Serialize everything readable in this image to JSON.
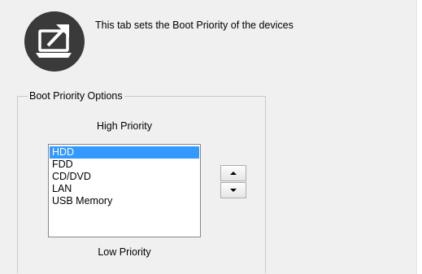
{
  "header": {
    "icon": "monitor-arrow-icon",
    "description": "This tab sets the Boot Priority of the devices"
  },
  "boot_options": {
    "group_label": "Boot Priority Options",
    "high_label": "High Priority",
    "low_label": "Low Priority",
    "items": [
      {
        "label": "HDD",
        "selected": true
      },
      {
        "label": "FDD",
        "selected": false
      },
      {
        "label": "CD/DVD",
        "selected": false
      },
      {
        "label": "LAN",
        "selected": false
      },
      {
        "label": "USB Memory",
        "selected": false
      }
    ],
    "move_up_icon": "triangle-up-icon",
    "move_down_icon": "triangle-down-icon"
  },
  "colors": {
    "panel_bg": "#f0f0f0",
    "selection": "#3399ff",
    "icon_circle": "#3a3a3a"
  }
}
